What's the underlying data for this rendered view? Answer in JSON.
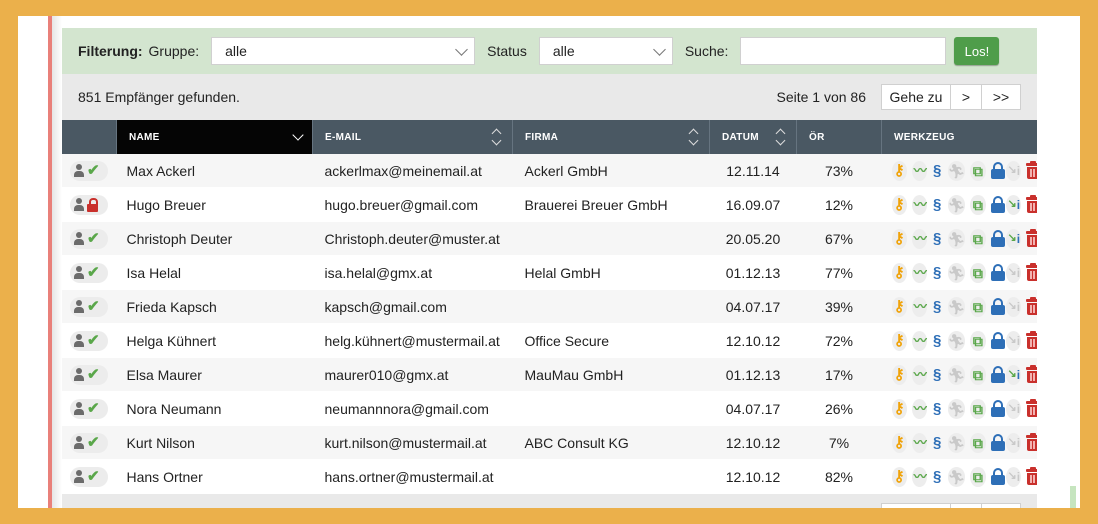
{
  "filter": {
    "title": "Filterung:",
    "group_label": "Gruppe:",
    "group_value": "alle",
    "status_label": "Status",
    "status_value": "alle",
    "search_label": "Suche:",
    "search_value": "",
    "go_label": "Los!"
  },
  "results": {
    "count_text": "851 Empfänger gefunden.",
    "page_text": "Seite 1 von 86",
    "goto_label": "Gehe zu",
    "next_label": ">",
    "last_label": ">>"
  },
  "columns": {
    "name": "NAME",
    "email": "E-MAIL",
    "firma": "FIRMA",
    "datum": "DATUM",
    "rate": "ÖR",
    "tools": "WERKZEUG"
  },
  "rows": [
    {
      "name": "Max Ackerl",
      "email": "ackerlmax@meinemail.at",
      "firma": "Ackerl GmbH",
      "datum": "12.11.14",
      "rate": "73%",
      "status": "active",
      "info_active": false
    },
    {
      "name": "Hugo Breuer",
      "email": "hugo.breuer@gmail.com",
      "firma": "Brauerei Breuer GmbH",
      "datum": "16.09.07",
      "rate": "12%",
      "status": "locked",
      "info_active": true
    },
    {
      "name": "Christoph Deuter",
      "email": "Christoph.deuter@muster.at",
      "firma": "",
      "datum": "20.05.20",
      "rate": "67%",
      "status": "active",
      "info_active": true
    },
    {
      "name": "Isa Helal",
      "email": "isa.helal@gmx.at",
      "firma": "Helal GmbH",
      "datum": "01.12.13",
      "rate": "77%",
      "status": "active",
      "info_active": false
    },
    {
      "name": "Frieda Kapsch",
      "email": "kapsch@gmail.com",
      "firma": "",
      "datum": "04.07.17",
      "rate": "39%",
      "status": "active",
      "info_active": false
    },
    {
      "name": "Helga Kühnert",
      "email": "helg.kühnert@mustermail.at",
      "firma": "Office Secure",
      "datum": "12.10.12",
      "rate": "72%",
      "status": "active",
      "info_active": false
    },
    {
      "name": "Elsa Maurer",
      "email": "maurer010@gmx.at",
      "firma": "MauMau GmbH",
      "datum": "01.12.13",
      "rate": "17%",
      "status": "active",
      "info_active": true
    },
    {
      "name": "Nora Neumann",
      "email": "neumannnora@gmail.com",
      "firma": "",
      "datum": "04.07.17",
      "rate": "26%",
      "status": "active",
      "info_active": false
    },
    {
      "name": "Kurt Nilson",
      "email": "kurt.nilson@mustermail.at",
      "firma": "ABC Consult KG",
      "datum": "12.10.12",
      "rate": "7%",
      "status": "active",
      "info_active": false
    },
    {
      "name": "Hans Ortner",
      "email": "hans.ortner@mustermail.at",
      "firma": "",
      "datum": "12.10.12",
      "rate": "82%",
      "status": "active",
      "info_active": false
    }
  ],
  "icons": {
    "key": "key-icon",
    "wave": "activity-icon",
    "para": "section-icon",
    "run": "runner-icon",
    "copy": "copy-icon",
    "lock": "lock-icon",
    "info": "info-icon",
    "trash": "trash-icon"
  },
  "colors": {
    "frame_background": "#ebb04b",
    "filter_background": "#d3e5cf",
    "header_background": "#4a5863",
    "active_sort_header": "#050505",
    "go_button": "#4f9d4a",
    "delete_red": "#c9302c",
    "lock_blue": "#2e6fb7"
  }
}
